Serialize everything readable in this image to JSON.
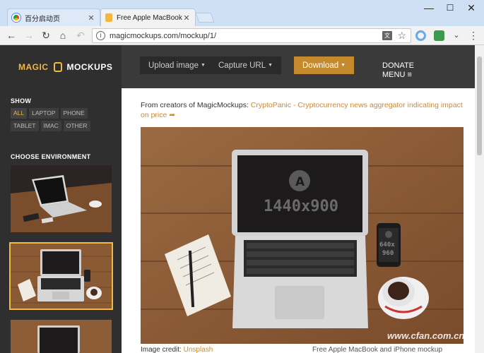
{
  "browser": {
    "tabs": [
      {
        "title": "百分启动页",
        "state": "inactive"
      },
      {
        "title": "Free Apple MacBook and",
        "state": "active"
      }
    ],
    "url": "magicmockups.com/mockup/1/",
    "win_controls": [
      "—",
      "☐",
      "✕"
    ]
  },
  "sidebar": {
    "logo_left": "MAGIC",
    "logo_right": "MOCKUPS",
    "show_heading": "SHOW",
    "filters": [
      "ALL",
      "LAPTOP",
      "PHONE",
      "TABLET",
      "IMAC",
      "OTHER"
    ],
    "active_filter": "ALL",
    "environment_heading": "CHOOSE ENVIRONMENT"
  },
  "header": {
    "upload": "Upload image",
    "capture": "Capture URL",
    "download": "Download",
    "donate": "DONATE",
    "menu": "MENU"
  },
  "content": {
    "promo_prefix": "From creators of MagicMockups: ",
    "promo_link": "CryptoPanic - Cryptocurrency news aggregator indicating impact on price",
    "screen_letter": "A",
    "screen_size": "1440x900",
    "phone_size_1": "640x",
    "phone_size_2": "960",
    "credit_prefix": "Image credit: ",
    "credit_link": "Unsplash",
    "caption": "Free Apple MacBook and iPhone mockup",
    "watermark": "www.cfan.com.cn"
  },
  "colors": {
    "accent": "#f5b73f",
    "download": "#c58a2d",
    "sidebar": "#2f2f2f",
    "header": "#3a3a3a"
  }
}
